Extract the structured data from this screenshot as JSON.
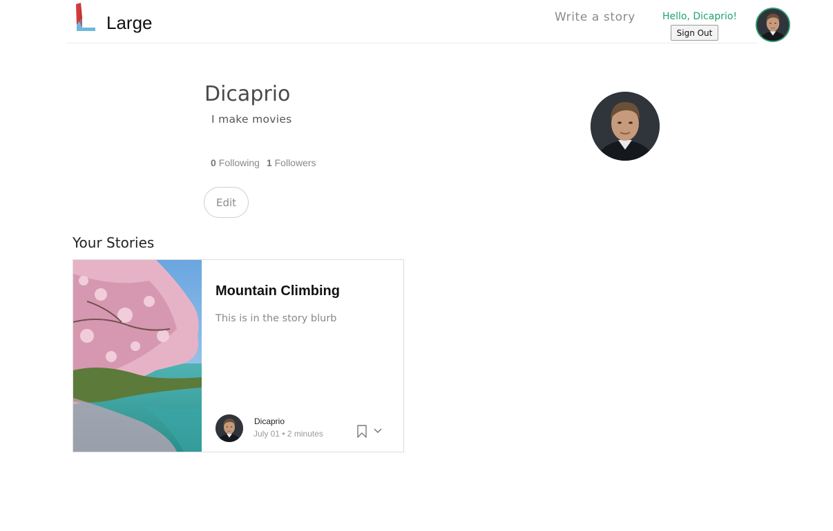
{
  "header": {
    "brand": "Large",
    "write_story": "Write a story",
    "greeting": "Hello, Dicaprio!",
    "sign_out": "Sign Out"
  },
  "profile": {
    "name": "Dicaprio",
    "bio": "I make movies",
    "following_count": "0",
    "following_label": "Following",
    "followers_count": "1",
    "followers_label": "Followers",
    "edit_label": "Edit"
  },
  "stories_section": {
    "heading": "Your Stories",
    "stories": [
      {
        "title": "Mountain Climbing",
        "blurb": "This is in the story blurb",
        "author": "Dicaprio",
        "meta": "July 01 • 2 minutes"
      }
    ]
  },
  "colors": {
    "accent_green": "#1ea36a",
    "logo_red": "#d23a3a",
    "logo_blue": "#6fb8db"
  },
  "icons": [
    "logo-icon",
    "avatar",
    "bookmark-icon",
    "chevron-down-icon"
  ]
}
